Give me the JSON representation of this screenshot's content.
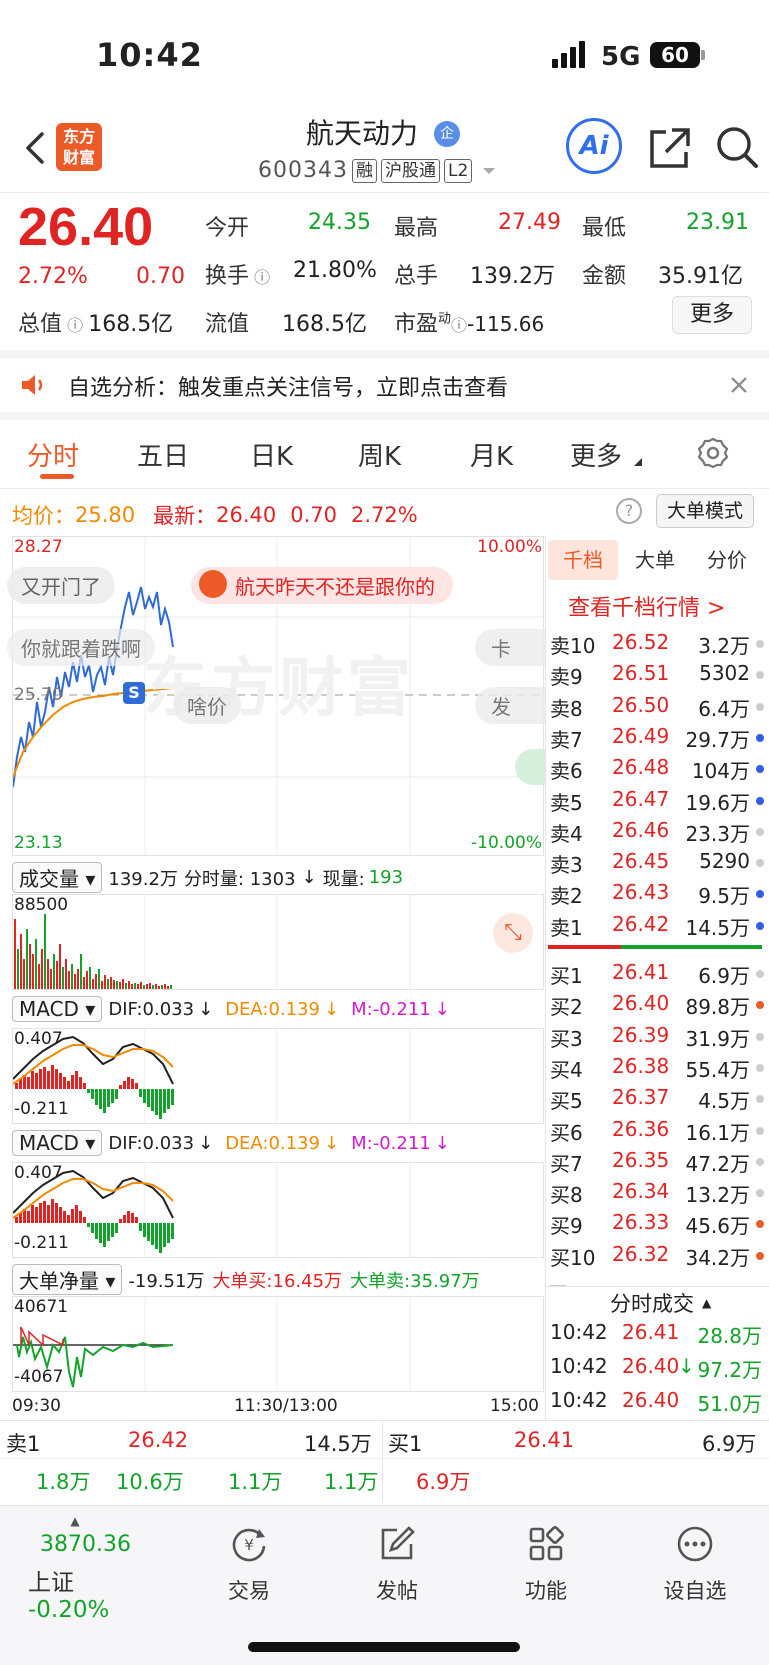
{
  "status": {
    "time": "10:42",
    "network": "5G",
    "battery": "60"
  },
  "header": {
    "logo_line1": "东方",
    "logo_line2": "财富",
    "stock_name": "航天动力",
    "badge": "企",
    "code": "600343",
    "tags": [
      "融",
      "沪股通",
      "L2"
    ],
    "ai_label": "Ai"
  },
  "quote": {
    "price": "26.40",
    "change_pct": "2.72%",
    "change": "0.70",
    "open_label": "今开",
    "open": "24.35",
    "high_label": "最高",
    "high": "27.49",
    "low_label": "最低",
    "low": "23.91",
    "turnover_label": "换手",
    "turnover": "21.80%",
    "volume_label": "总手",
    "volume": "139.2万",
    "amount_label": "金额",
    "amount": "35.91亿",
    "mktcap_label": "总值",
    "mktcap": "168.5亿",
    "float_label": "流值",
    "float": "168.5亿",
    "pe_label": "市盈",
    "pe_sup": "动",
    "pe": "-115.66",
    "more_label": "更多"
  },
  "notice": {
    "text": "自选分析：触发重点关注信号，立即点击查看"
  },
  "tabs": [
    "分时",
    "五日",
    "日K",
    "周K",
    "月K",
    "更多"
  ],
  "chart": {
    "avg_label": "均价：",
    "avg": "25.80",
    "latest_label": "最新：",
    "latest": "26.40",
    "latest_chg": "0.70",
    "latest_pct": "2.72%",
    "mode_btn": "大单模式",
    "y_top": "28.27",
    "y_mid": "25.70",
    "y_bottom": "23.13",
    "pct_top": "10.00%",
    "pct_bottom": "-10.00%",
    "watermark": "东方财富",
    "danmaku": [
      "又开门了",
      "航天昨天不还是跟你的",
      "你就跟着跌啊",
      "啥价",
      "卡",
      "发"
    ],
    "x_labels": [
      "09:30",
      "11:30/13:00",
      "15:00"
    ]
  },
  "volume": {
    "sel": "成交量",
    "total": "139.2万",
    "seg_label": "分时量: 1303",
    "cur_label": "现量:",
    "cur": "193",
    "max": "88500"
  },
  "macd1": {
    "sel": "MACD",
    "dif": "DIF:0.033",
    "dea": "DEA:0.139",
    "m": "M:-0.211",
    "top": "0.407",
    "bottom": "-0.211"
  },
  "macd2": {
    "sel": "MACD",
    "dif": "DIF:0.033",
    "dea": "DEA:0.139",
    "m": "M:-0.211",
    "top": "0.407",
    "bottom": "-0.211"
  },
  "bignet": {
    "sel": "大单净量",
    "net": "-19.51万",
    "buy": "大单买:16.45万",
    "sell": "大单卖:35.97万",
    "top": "40671",
    "bottom": "-4067"
  },
  "orderbook": {
    "tabs": [
      "千档",
      "大单",
      "分价"
    ],
    "view_link": "查看千档行情 >",
    "sells": [
      {
        "label": "卖10",
        "price": "26.52",
        "vol": "3.2万",
        "dot": "#cccccc"
      },
      {
        "label": "卖9",
        "price": "26.51",
        "vol": "5302",
        "dot": "#cccccc"
      },
      {
        "label": "卖8",
        "price": "26.50",
        "vol": "6.4万",
        "dot": "#cccccc"
      },
      {
        "label": "卖7",
        "price": "26.49",
        "vol": "29.7万",
        "dot": "#2f5fe0"
      },
      {
        "label": "卖6",
        "price": "26.48",
        "vol": "104万",
        "dot": "#2f5fe0"
      },
      {
        "label": "卖5",
        "price": "26.47",
        "vol": "19.6万",
        "dot": "#2f5fe0"
      },
      {
        "label": "卖4",
        "price": "26.46",
        "vol": "23.3万",
        "dot": "#cccccc"
      },
      {
        "label": "卖3",
        "price": "26.45",
        "vol": "5290",
        "dot": "#cccccc"
      },
      {
        "label": "卖2",
        "price": "26.43",
        "vol": "9.5万",
        "dot": "#2f5fe0"
      },
      {
        "label": "卖1",
        "price": "26.42",
        "vol": "14.5万",
        "dot": "#2f5fe0"
      }
    ],
    "buys": [
      {
        "label": "买1",
        "price": "26.41",
        "vol": "6.9万",
        "dot": "#cccccc"
      },
      {
        "label": "买2",
        "price": "26.40",
        "vol": "89.8万",
        "dot": "#ec5a28"
      },
      {
        "label": "买3",
        "price": "26.39",
        "vol": "31.9万",
        "dot": "#cccccc"
      },
      {
        "label": "买4",
        "price": "26.38",
        "vol": "55.4万",
        "dot": "#cccccc"
      },
      {
        "label": "买5",
        "price": "26.37",
        "vol": "4.5万",
        "dot": "#cccccc"
      },
      {
        "label": "买6",
        "price": "26.36",
        "vol": "16.1万",
        "dot": "#cccccc"
      },
      {
        "label": "买7",
        "price": "26.35",
        "vol": "47.2万",
        "dot": "#cccccc"
      },
      {
        "label": "买8",
        "price": "26.34",
        "vol": "13.2万",
        "dot": "#cccccc"
      },
      {
        "label": "买9",
        "price": "26.33",
        "vol": "45.6万",
        "dot": "#ec5a28"
      },
      {
        "label": "买10",
        "price": "26.32",
        "vol": "34.2万",
        "dot": "#ec5a28"
      }
    ],
    "ticks_title": "分时成交",
    "ticks": [
      {
        "time": "10:42",
        "price": "26.41",
        "vol": "28.8万",
        "arrow": ""
      },
      {
        "time": "10:42",
        "price": "26.40",
        "vol": "97.2万",
        "arrow": "↓"
      },
      {
        "time": "10:42",
        "price": "26.40",
        "vol": "51.0万",
        "arrow": ""
      }
    ]
  },
  "bottom_quote": {
    "sell_label": "卖1",
    "sell_price": "26.42",
    "sell_vol": "14.5万",
    "buy_label": "买1",
    "buy_price": "26.41",
    "buy_vol": "6.9万",
    "sell_queue": [
      "1.8万",
      "10.6万",
      "1.1万",
      "1.1万"
    ],
    "buy_queue": [
      "6.9万"
    ]
  },
  "bottom_nav": {
    "index_value": "3870.36",
    "index_name": "上证",
    "index_chg": "-0.20%",
    "items": [
      "交易",
      "发帖",
      "功能",
      "设自选"
    ]
  }
}
